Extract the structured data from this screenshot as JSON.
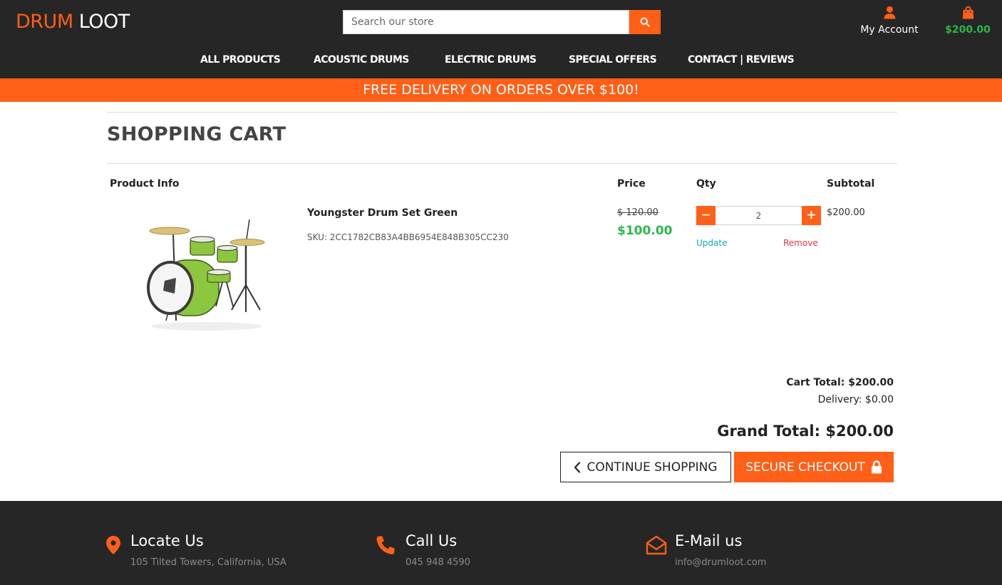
{
  "header": {
    "logo_part1": "DRUM",
    "logo_part2": "LOOT",
    "search_placeholder": "Search our store",
    "account_label": "My Account",
    "cart_amount": "$200.00",
    "accent_color": "#ff5f17",
    "price_color": "#2bb84a",
    "icons": {
      "search": "search-icon",
      "account": "user-icon",
      "cart": "shopping-bag-icon"
    }
  },
  "nav": {
    "items": [
      "ALL PRODUCTS",
      "ACOUSTIC DRUMS",
      "ELECTRIC DRUMS",
      "SPECIAL OFFERS",
      "CONTACT | REVIEWS"
    ]
  },
  "banner": {
    "text": "FREE DELIVERY ON ORDERS OVER $100!"
  },
  "cart": {
    "title": "SHOPPING CART",
    "columns": {
      "product_info": "Product Info",
      "price": "Price",
      "qty": "Qty",
      "subtotal": "Subtotal"
    },
    "items": [
      {
        "name": "Youngster Drum Set Green",
        "sku": "SKU: 2CC1782CB83A4BB6954E848B305CC230",
        "old_price": "$ 120.00",
        "price": "$100.00",
        "qty": "2",
        "qty_minus": "−",
        "qty_plus": "+",
        "update_label": "Update",
        "remove_label": "Remove",
        "subtotal": "$200.00"
      }
    ],
    "cart_total": "Cart Total: $200.00",
    "delivery": "Delivery: $0.00",
    "grand_total": "Grand Total: $200.00",
    "continue_label": "CONTINUE SHOPPING",
    "checkout_label": "SECURE CHECKOUT"
  },
  "footer": {
    "locate": {
      "heading": "Locate Us",
      "text": "105 Tilted Towers, California, USA",
      "icon": "map-marker-icon"
    },
    "call": {
      "heading": "Call Us",
      "text": "045 948 4590",
      "icon": "phone-icon"
    },
    "email": {
      "heading": "E-Mail us",
      "text": "info@drumloot.com",
      "icon": "envelope-open-icon"
    }
  }
}
